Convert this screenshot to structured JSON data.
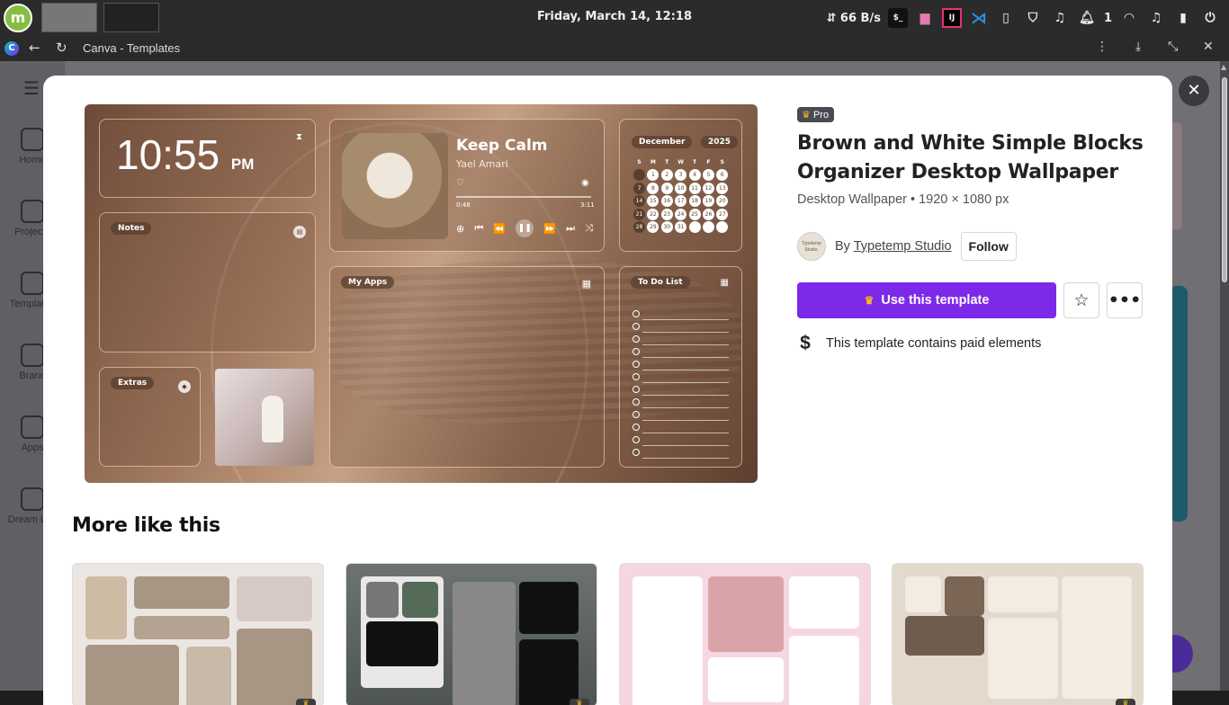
{
  "taskbar": {
    "clock": "Friday, March 14, 12:18",
    "net_speed": "⇵ 66 B/s",
    "notif_count": "1"
  },
  "browser": {
    "tab_title": "Canva - Templates"
  },
  "sidebar": {
    "items": [
      {
        "label": "Home"
      },
      {
        "label": "Projects"
      },
      {
        "label": "Templates"
      },
      {
        "label": "Brand"
      },
      {
        "label": "Apps"
      },
      {
        "label": "Dream Lab"
      }
    ]
  },
  "template": {
    "badge": "Pro",
    "title": "Brown and White Simple Blocks Organizer Desktop Wallpaper",
    "subtitle": "Desktop Wallpaper • 1920 × 1080 px",
    "by": "By",
    "author": "Typetemp Studio",
    "avatar_text": "Typetemp Studio.",
    "follow_label": "Follow",
    "use_label": "Use this template",
    "paid_note": "This template contains paid elements"
  },
  "preview": {
    "time": "10:55",
    "ampm": "PM",
    "song": "Keep Calm",
    "artist": "Yael Amari",
    "elapsed": "0:48",
    "duration": "3:11",
    "month": "December",
    "year": "2025",
    "labels": {
      "notes": "Notes",
      "apps": "My Apps",
      "todo": "To Do List",
      "extras": "Extras"
    },
    "weekdays": [
      "S",
      "M",
      "T",
      "W",
      "T",
      "F",
      "S"
    ],
    "days": [
      "",
      "1",
      "2",
      "3",
      "4",
      "5",
      "6",
      "7",
      "8",
      "9",
      "10",
      "11",
      "12",
      "13",
      "14",
      "15",
      "16",
      "17",
      "18",
      "19",
      "20",
      "21",
      "22",
      "23",
      "24",
      "25",
      "26",
      "27",
      "28",
      "29",
      "30",
      "31",
      "",
      "",
      ""
    ]
  },
  "more_section": {
    "heading": "More like this"
  }
}
